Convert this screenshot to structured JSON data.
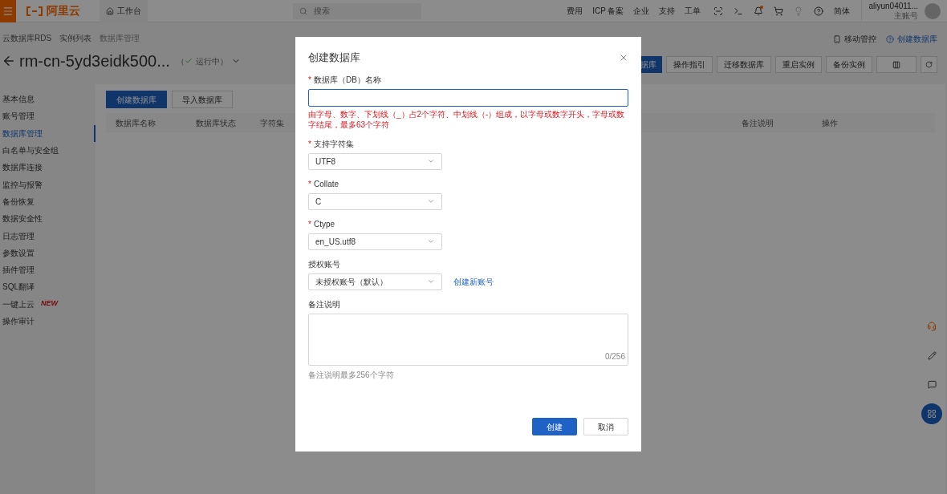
{
  "topbar": {
    "logo": "阿里云",
    "workbench": "工作台",
    "search_placeholder": "搜索",
    "links": [
      "费用",
      "ICP 备案",
      "企业",
      "支持",
      "工单"
    ],
    "language": "简体",
    "account": "aliyun04011...",
    "account_type": "主账号"
  },
  "breadcrumb": [
    "云数据库RDS",
    "实例列表",
    "数据库管理"
  ],
  "instance": {
    "name": "rm-cn-5yd3eidk500...",
    "status": "运行中",
    "open_paren": "（",
    "close_paren": "）"
  },
  "header_links": [
    "移动管控",
    "创建数据库"
  ],
  "actions": [
    {
      "label": "据库",
      "kind": "primary"
    },
    {
      "label": "操作指引",
      "kind": "default"
    },
    {
      "label": "迁移数据库",
      "kind": "default"
    },
    {
      "label": "重启实例",
      "kind": "default"
    },
    {
      "label": "备份实例",
      "kind": "default"
    }
  ],
  "sidebar": {
    "items": [
      {
        "label": "基本信息",
        "selected": false
      },
      {
        "label": "账号管理",
        "selected": false
      },
      {
        "label": "数据库管理",
        "selected": true
      },
      {
        "label": "白名单与安全组",
        "selected": false
      },
      {
        "label": "数据库连接",
        "selected": false
      },
      {
        "label": "监控与报警",
        "selected": false
      },
      {
        "label": "备份恢复",
        "selected": false
      },
      {
        "label": "数据安全性",
        "selected": false
      },
      {
        "label": "日志管理",
        "selected": false
      },
      {
        "label": "参数设置",
        "selected": false
      },
      {
        "label": "插件管理",
        "selected": false
      },
      {
        "label": "SQL翻译",
        "selected": false
      },
      {
        "label": "一键上云",
        "selected": false,
        "badge": "NEW"
      },
      {
        "label": "操作审计",
        "selected": false
      }
    ]
  },
  "content_buttons": [
    {
      "label": "创建数据库",
      "kind": "primary"
    },
    {
      "label": "导入数据库",
      "kind": "default"
    }
  ],
  "table": {
    "columns": [
      "数据库名称",
      "数据库状态",
      "字符集",
      "备注说明",
      "操作"
    ]
  },
  "modal": {
    "title": "创建数据库",
    "required_mark": "*",
    "fields": [
      {
        "kind": "text",
        "label": "数据库（DB）名称",
        "required": true,
        "error": "由字母、数字、下划线（_）占2个字符、中划线（-）组成，以字母或数字开头，字母或数字结尾，最多63个字符"
      },
      {
        "kind": "select",
        "label": "支持字符集",
        "required": true,
        "value": "UTF8"
      },
      {
        "kind": "select",
        "label": "Collate",
        "required": true,
        "value": "C"
      },
      {
        "kind": "select",
        "label": "Ctype",
        "required": true,
        "value": "en_US.utf8"
      },
      {
        "kind": "select",
        "label": "授权账号",
        "required": false,
        "value": "未授权账号（默认）",
        "link": "创建新账号"
      },
      {
        "kind": "textarea",
        "label": "备注说明",
        "required": false,
        "counter": "0/256",
        "help": "备注说明最多256个字符"
      }
    ],
    "buttons": [
      {
        "label": "创建",
        "kind": "primary"
      },
      {
        "label": "取消",
        "kind": "default"
      }
    ]
  }
}
